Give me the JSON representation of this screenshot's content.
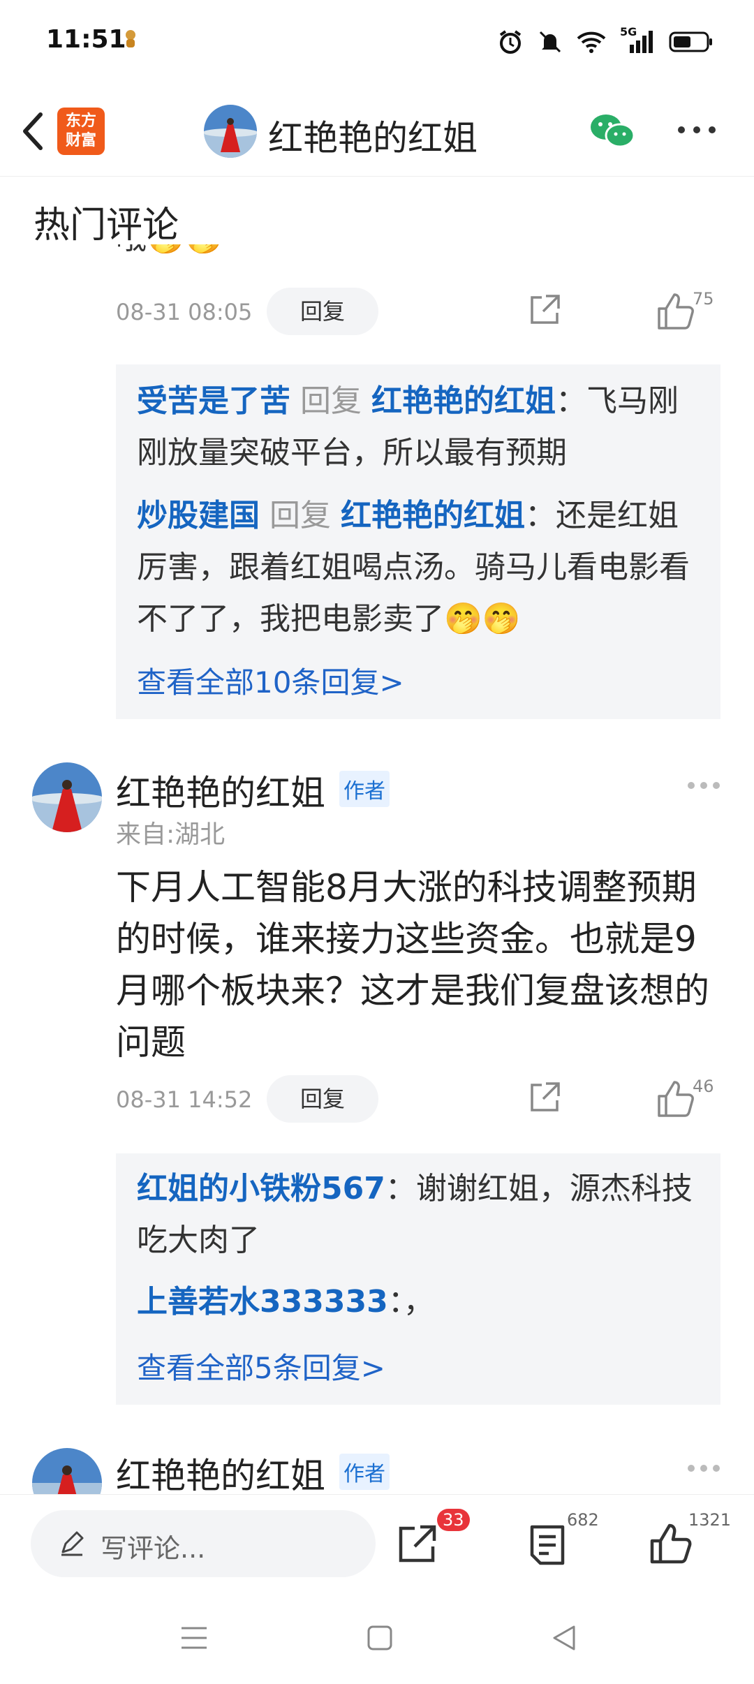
{
  "status_bar": {
    "time": "11:51",
    "network": "5G"
  },
  "header": {
    "title": "红艳艳的红姐",
    "logo_text_line1": "东方",
    "logo_text_line2": "财富"
  },
  "section_title": "热门评论",
  "comments": [
    {
      "partial_text": "哦🤭🤭",
      "time": "08-31 08:05",
      "reply_label": "回复",
      "likes": "75",
      "replies": [
        {
          "user": "受苦是了苦",
          "reply_word": "回复",
          "target": "红艳艳的红姐",
          "text": "：飞马刚刚放量突破平台，所以最有预期"
        },
        {
          "user": "炒股建国",
          "reply_word": "回复",
          "target": "红艳艳的红姐",
          "text": "：还是红姐厉害，跟着红姐喝点汤。骑马儿看电影看不了了，我把电影卖了🤭🤭"
        }
      ],
      "view_all": "查看全部10条回复>"
    },
    {
      "author": "红艳艳的红姐",
      "badge": "作者",
      "from": "来自:湖北",
      "body": "下月人工智能8月大涨的科技调整预期的时候，谁来接力这些资金。也就是9月哪个板块来？这才是我们复盘该想的问题",
      "time": "08-31 14:52",
      "reply_label": "回复",
      "likes": "46",
      "replies": [
        {
          "user": "红姐的小铁粉567",
          "text": "：谢谢红姐，源杰科技吃大肉了"
        },
        {
          "user": "上善若水333333",
          "text": "：，"
        }
      ],
      "view_all": "查看全部5条回复>"
    },
    {
      "author": "红艳艳的红姐",
      "badge": "作者"
    }
  ],
  "bottom_bar": {
    "placeholder": "写评论...",
    "share_badge": "33",
    "comments_count": "682",
    "likes_count": "1321"
  },
  "colors": {
    "accent_blue": "#1565c0",
    "badge_red": "#e8343a",
    "logo_orange": "#f05a1a"
  }
}
